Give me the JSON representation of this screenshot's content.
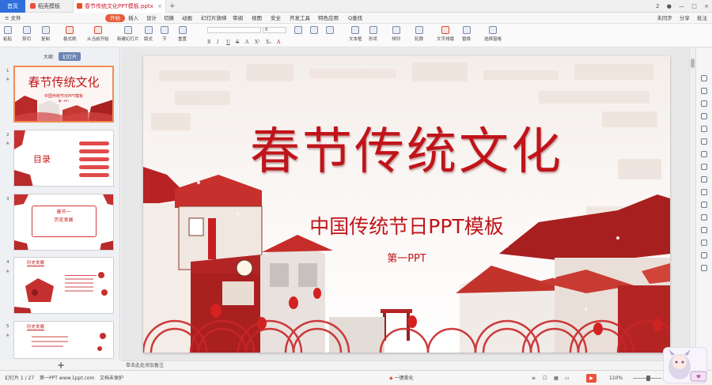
{
  "tabs": {
    "home": "首页",
    "template": "稻壳模板",
    "document": "春节传统文化PPT模板.pptx",
    "close": "×",
    "add": "+"
  },
  "window_right": {
    "count": "2",
    "minimize": "—",
    "maximize": "□",
    "close": "×"
  },
  "menu": {
    "file": "≡ 文件",
    "start": "开始",
    "items": [
      "插入",
      "设计",
      "切换",
      "动画",
      "幻灯片放映",
      "审阅",
      "视图",
      "安全",
      "开发工具",
      "特色应用",
      "Q查找"
    ],
    "right": [
      "未同步",
      "分享",
      "批注"
    ]
  },
  "ribbon": {
    "buttons": [
      "粘贴",
      "剪切",
      "复制",
      "格式刷",
      "从当前开始",
      "新建幻灯片",
      "版式",
      "节",
      "重置"
    ],
    "font_value": "",
    "size_value": "0",
    "format_marks": [
      "B",
      "I",
      "U",
      "S",
      "A",
      "X²",
      "X₂",
      "A"
    ],
    "right_buttons": [
      "文本框",
      "形状",
      "排列",
      "轮廓",
      "文字排版",
      "替换",
      "选择窗格"
    ]
  },
  "sidebar": {
    "tabs": [
      "大纲",
      "幻灯片"
    ],
    "active_tab": "幻灯片",
    "slides": [
      {
        "num": "1",
        "title": "春节传统文化",
        "subtitle": "中国传统节日PPT模板",
        "small": "第一PPT"
      },
      {
        "num": "2",
        "title": "目录"
      },
      {
        "num": "3",
        "title": "章节一\n历史发展"
      },
      {
        "num": "4",
        "title": "历史发展"
      },
      {
        "num": "5",
        "title": "历史发展"
      }
    ],
    "add": "+"
  },
  "slide": {
    "title": "春节传统文化",
    "subtitle": "中国传统节日PPT模板",
    "subtitle2": "第一PPT"
  },
  "notes_placeholder": "单击此处添加备注",
  "status": {
    "slide_info": "幻灯片 1 / 27",
    "theme": "第一PPT www.1ppt.com",
    "protect": "文档未保护",
    "beautify": "一键美化",
    "zoom": "110%",
    "view_marks": [
      "≡",
      "☐",
      "▦",
      "▭"
    ]
  },
  "colors": {
    "brand_red": "#c0141a",
    "accent_orange": "#e85a3b",
    "home_tab_blue": "#2f6edb"
  }
}
